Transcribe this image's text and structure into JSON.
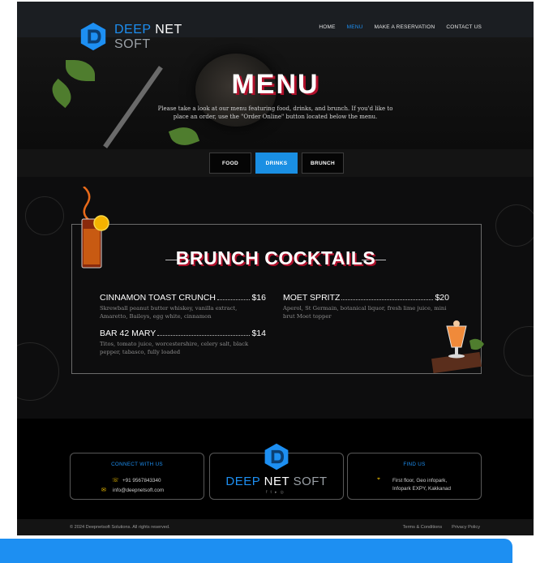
{
  "header": {
    "logo": {
      "word1": "DEEP",
      "word2": "NET",
      "word3": "SOFT"
    },
    "nav": [
      {
        "label": "HOME",
        "active": false
      },
      {
        "label": "MENU",
        "active": true
      },
      {
        "label": "MAKE A RESERVATION",
        "active": false
      },
      {
        "label": "CONTACT US",
        "active": false
      }
    ]
  },
  "hero": {
    "title": "MENU",
    "intro": "Please take a look at our menu featuring food, drinks, and brunch. If you'd like to place an order, use the \"Order Online\" button located below the menu."
  },
  "tabs": [
    {
      "label": "FOOD",
      "active": false
    },
    {
      "label": "DRINKS",
      "active": true
    },
    {
      "label": "BRUNCH",
      "active": false
    }
  ],
  "menu": {
    "title": "BRUNCH COCKTAILS",
    "items": [
      {
        "name": "CINNAMON TOAST CRUNCH",
        "price": "$16",
        "desc": "Skrewball peanut butter whiskey, vanilla extract, Amaretto, Baileys, egg white, cinnamon"
      },
      {
        "name": "MOET SPRITZ",
        "price": "$20",
        "desc": "Aperol, St Germain, botanical liquor, fresh lime juice, mini brut Moet topper"
      },
      {
        "name": "BAR 42 MARY",
        "price": "$14",
        "desc": "Titos, tomato juice, worcestershire, celery salt, black pepper, tabasco, fully loaded"
      }
    ]
  },
  "footer": {
    "connect": {
      "title": "CONNECT WITH US",
      "phone": "+91 9567843340",
      "email": "info@deepnetsoft.com"
    },
    "brand": {
      "word1": "DEEP",
      "word2": "NET",
      "word3": "SOFT"
    },
    "find": {
      "title": "FIND US",
      "line1": "First floor, Geo infopark,",
      "line2": "Infopark EXPY, Kakkanad"
    },
    "copyright": "© 2024 Deepnetsoft Solutions. All rights reserved.",
    "links": [
      "Terms & Conditions",
      "Privacy Policy"
    ]
  },
  "colors": {
    "accent": "#1d8ff2",
    "title_shadow": "#b0102b",
    "background": "#0b0b0c"
  }
}
